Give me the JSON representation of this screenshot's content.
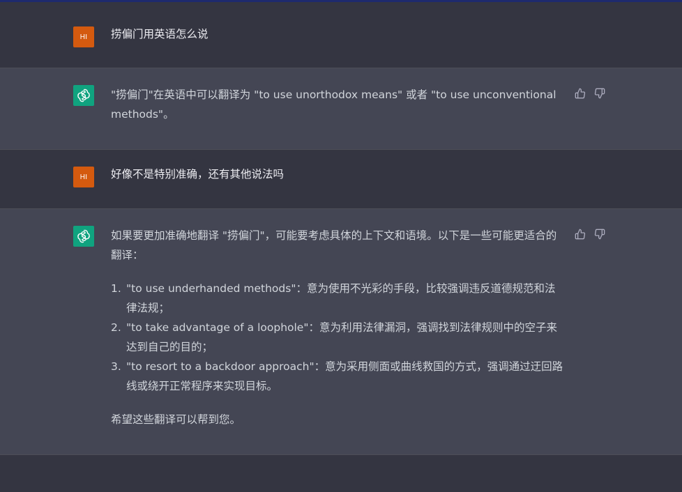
{
  "conversation": {
    "user_avatar_text": "HI",
    "messages": [
      {
        "role": "user",
        "text": "捞偏门用英语怎么说"
      },
      {
        "role": "assistant",
        "text": "\"捞偏门\"在英语中可以翻译为 \"to use unorthodox means\" 或者 \"to use unconventional methods\"。"
      },
      {
        "role": "user",
        "text": "好像不是特别准确，还有其他说法吗"
      },
      {
        "role": "assistant",
        "intro": "如果要更加准确地翻译 \"捞偏门\"，可能要考虑具体的上下文和语境。以下是一些可能更适合的翻译：",
        "points": [
          {
            "num": "1.",
            "text": "\"to use underhanded methods\"：意为使用不光彩的手段，比较强调违反道德规范和法律法规；"
          },
          {
            "num": "2.",
            "text": "\"to take advantage of a loophole\"：意为利用法律漏洞，强调找到法律规则中的空子来达到自己的目的；"
          },
          {
            "num": "3.",
            "text": "\"to resort to a backdoor approach\"：意为采用侧面或曲线救国的方式，强调通过迂回路线或绕开正常程序来实现目标。"
          }
        ],
        "outro": "希望这些翻译可以帮到您。"
      }
    ]
  },
  "icons": {
    "thumbs_up": "thumbs-up-icon",
    "thumbs_down": "thumbs-down-icon",
    "assistant_logo": "openai-logo-icon"
  },
  "colors": {
    "user_avatar": "#d45a0f",
    "assistant_avatar": "#10a37f",
    "user_bg": "#343541",
    "assistant_bg": "#444654"
  }
}
